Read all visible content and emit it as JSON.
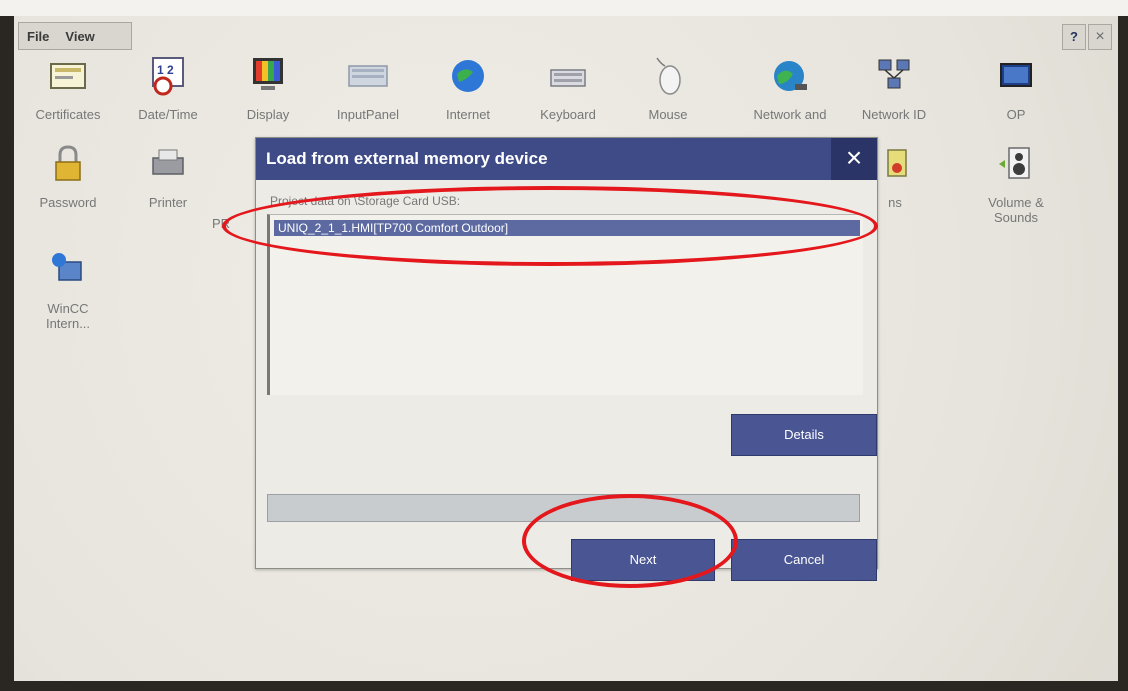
{
  "menu": [
    "File",
    "View"
  ],
  "window_controls": {
    "help": "?",
    "close": "×"
  },
  "desktop_icons": [
    {
      "label": "Certificates",
      "icon": "certificates-icon"
    },
    {
      "label": "Date/Time",
      "icon": "calendar-clock-icon"
    },
    {
      "label": "Display",
      "icon": "display-icon"
    },
    {
      "label": "InputPanel",
      "icon": "keyboard-panel-icon"
    },
    {
      "label": "Internet",
      "icon": "globe-icon"
    },
    {
      "label": "Keyboard",
      "icon": "keyboard-icon"
    },
    {
      "label": "Mouse",
      "icon": "mouse-icon"
    },
    {
      "label": "Network and",
      "icon": "network-globe-icon"
    },
    {
      "label": "Network ID",
      "icon": "network-id-icon"
    },
    {
      "label": "OP",
      "icon": "monitor-icon"
    },
    {
      "label": "Password",
      "icon": "padlock-icon"
    },
    {
      "label": "Printer",
      "icon": "printer-icon"
    },
    {
      "label": "Volume & Sounds",
      "icon": "speaker-icon"
    },
    {
      "label": "WinCC Intern...",
      "icon": "wincc-icon"
    }
  ],
  "partial_labels": {
    "printer_neighbor": "PR",
    "hidden_icon_suffix": "ns"
  },
  "dialog": {
    "title": "Load from external memory device",
    "close": "×",
    "label": "Project data on \\Storage Card USB:",
    "selected_item": "UNIQ_2_1_1.HMI[TP700 Comfort Outdoor]",
    "details_button": "Details",
    "next_button": "Next",
    "cancel_button": "Cancel"
  },
  "colors": {
    "title_bar": "#3f4b86",
    "button": "#4a5694",
    "highlight": "#e4171c"
  }
}
